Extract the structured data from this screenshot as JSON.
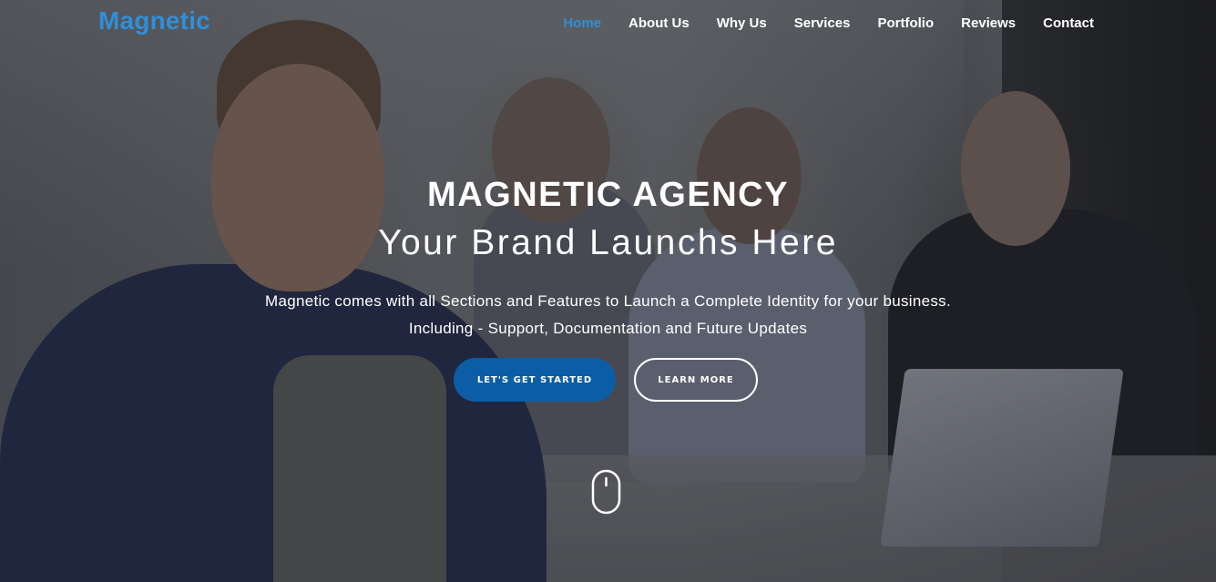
{
  "nav": {
    "logo": "Magnetic",
    "items": [
      {
        "label": "Home",
        "active": true
      },
      {
        "label": "About Us",
        "active": false
      },
      {
        "label": "Why Us",
        "active": false
      },
      {
        "label": "Services",
        "active": false
      },
      {
        "label": "Portfolio",
        "active": false
      },
      {
        "label": "Reviews",
        "active": false
      },
      {
        "label": "Contact",
        "active": false
      }
    ]
  },
  "hero": {
    "title": "MAGNETIC AGENCY",
    "subtitle": "Your Brand Launchs Here",
    "description_line1": "Magnetic comes with all Sections and Features to Launch a Complete Identity for your business.",
    "description_line2": "Including - Support, Documentation and Future Updates",
    "primary_button": "LET'S GET STARTED",
    "secondary_button": "LEARN MORE",
    "scroll_icon": "mouse-scroll-icon"
  },
  "colors": {
    "accent": "#2f8fd8",
    "primary_button_bg": "#0b5ea5",
    "text": "#ffffff"
  }
}
